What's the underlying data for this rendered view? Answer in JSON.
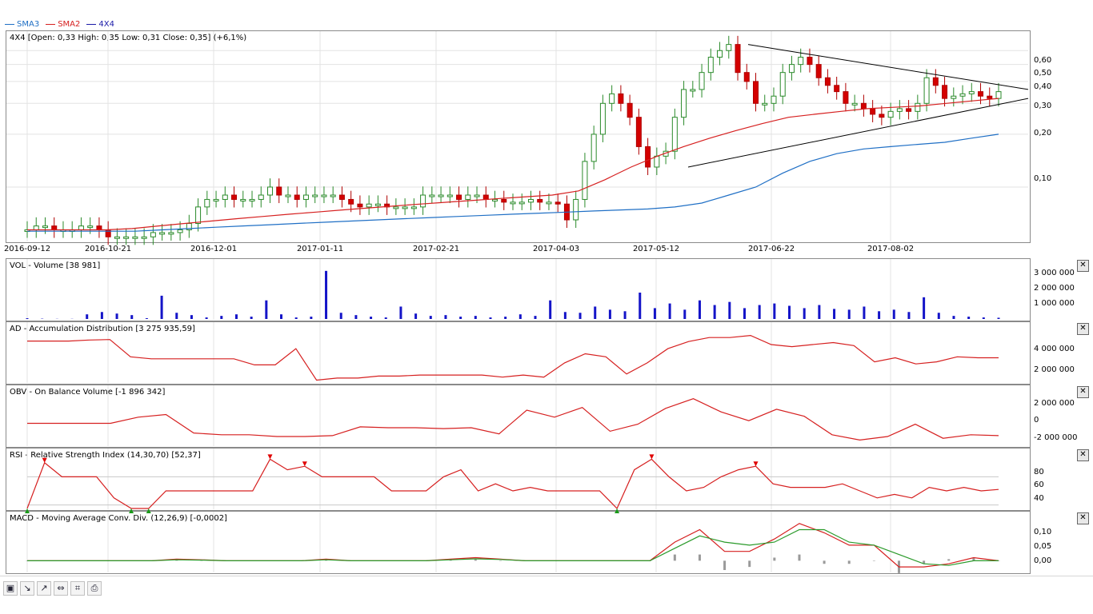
{
  "legend": [
    {
      "name": "SMA3",
      "color": "#1f6fc5"
    },
    {
      "name": "SMA2",
      "color": "#d62020"
    },
    {
      "name": "4X4",
      "color": "#1a1aa8"
    }
  ],
  "main_panel": {
    "title": "4X4 [Open: 0,33  High: 0,35  Low: 0,31  Close: 0,35] (+6,1%)",
    "y_ticks": [
      "0,60",
      "0,50",
      "0,40",
      "0,30",
      "0,20",
      "0,10"
    ],
    "x_ticks": [
      "2016-09-12",
      "2016-10-21",
      "2016-12-01",
      "2017-01-11",
      "2017-02-21",
      "2017-04-03",
      "2017-05-12",
      "2017-06-22",
      "2017-08-02"
    ]
  },
  "vol_panel": {
    "title": "VOL - Volume [38 981]",
    "y_ticks": [
      "3 000 000",
      "2 000 000",
      "1 000 000"
    ]
  },
  "ad_panel": {
    "title": "AD - Accumulation Distribution [3 275 935,59]",
    "y_ticks": [
      "4 000 000",
      "2 000 000"
    ]
  },
  "obv_panel": {
    "title": "OBV - On Balance Volume [-1 896 342]",
    "y_ticks": [
      "2 000 000",
      "0",
      "-2 000 000"
    ]
  },
  "rsi_panel": {
    "title": "RSI - Relative Strength Index (14,30,70) [52,37]",
    "y_ticks": [
      "80",
      "60",
      "40"
    ]
  },
  "macd_panel": {
    "title": "MACD - Moving Average Conv. Div. (12,26,9) [-0,0002]",
    "y_ticks": [
      "0,10",
      "0,05",
      "0,00"
    ]
  },
  "toolbar": {
    "icons": [
      "save-icon",
      "zoom-in-icon",
      "zoom-out-icon",
      "zoom-fit-icon",
      "fit-screen-icon",
      "print-icon"
    ]
  },
  "close_label": "✕",
  "chart_data": [
    {
      "type": "candlestick",
      "title": "4X4",
      "x_ticks": [
        "2016-09-12",
        "2016-10-21",
        "2016-12-01",
        "2017-01-11",
        "2017-02-21",
        "2017-04-03",
        "2017-05-12",
        "2017-06-22",
        "2017-08-02"
      ],
      "y_scale": "log",
      "ylim": [
        0.05,
        0.75
      ],
      "close": [
        0.057,
        0.06,
        0.06,
        0.057,
        0.057,
        0.057,
        0.06,
        0.06,
        0.057,
        0.052,
        0.052,
        0.052,
        0.052,
        0.052,
        0.055,
        0.055,
        0.055,
        0.057,
        0.062,
        0.077,
        0.085,
        0.085,
        0.09,
        0.085,
        0.085,
        0.085,
        0.09,
        0.1,
        0.09,
        0.09,
        0.085,
        0.09,
        0.09,
        0.09,
        0.09,
        0.085,
        0.08,
        0.077,
        0.08,
        0.08,
        0.077,
        0.077,
        0.077,
        0.077,
        0.09,
        0.09,
        0.09,
        0.09,
        0.085,
        0.09,
        0.09,
        0.085,
        0.085,
        0.082,
        0.082,
        0.082,
        0.085,
        0.082,
        0.082,
        0.08,
        0.065,
        0.085,
        0.14,
        0.2,
        0.3,
        0.34,
        0.3,
        0.25,
        0.17,
        0.13,
        0.15,
        0.16,
        0.25,
        0.36,
        0.36,
        0.45,
        0.55,
        0.6,
        0.65,
        0.45,
        0.4,
        0.3,
        0.3,
        0.33,
        0.45,
        0.5,
        0.55,
        0.5,
        0.42,
        0.38,
        0.35,
        0.3,
        0.3,
        0.28,
        0.26,
        0.25,
        0.27,
        0.28,
        0.27,
        0.3,
        0.42,
        0.38,
        0.32,
        0.33,
        0.34,
        0.35,
        0.33,
        0.32,
        0.35
      ],
      "sma_long": [
        0.056,
        0.056,
        0.056,
        0.056,
        0.056,
        0.057,
        0.058,
        0.059,
        0.06,
        0.061,
        0.062,
        0.063,
        0.064,
        0.065,
        0.066,
        0.067,
        0.068,
        0.069,
        0.07,
        0.071,
        0.072,
        0.073,
        0.074,
        0.075,
        0.077,
        0.081,
        0.09,
        0.1,
        0.12,
        0.14,
        0.155,
        0.165,
        0.17,
        0.175,
        0.18,
        0.19,
        0.2
      ],
      "sma_short": [
        0.057,
        0.057,
        0.057,
        0.057,
        0.058,
        0.06,
        0.062,
        0.064,
        0.066,
        0.068,
        0.07,
        0.072,
        0.074,
        0.076,
        0.078,
        0.08,
        0.082,
        0.084,
        0.086,
        0.088,
        0.09,
        0.095,
        0.11,
        0.13,
        0.15,
        0.17,
        0.19,
        0.21,
        0.23,
        0.25,
        0.26,
        0.27,
        0.28,
        0.285,
        0.29,
        0.3,
        0.31,
        0.32
      ],
      "trendlines": [
        {
          "from": [
            0.65
          ],
          "to": [
            0.36
          ]
        },
        {
          "from": [
            0.13
          ],
          "to": [
            0.32
          ]
        }
      ]
    },
    {
      "type": "bar",
      "title": "VOL - Volume",
      "values": [
        50000,
        20000,
        10000,
        10000,
        300000,
        450000,
        350000,
        250000,
        50000,
        1500000,
        400000,
        250000,
        100000,
        200000,
        300000,
        150000,
        1200000,
        300000,
        100000,
        150000,
        3100000,
        400000,
        250000,
        150000,
        100000,
        800000,
        350000,
        200000,
        250000,
        150000,
        200000,
        100000,
        150000,
        300000,
        200000,
        1200000,
        450000,
        400000,
        800000,
        600000,
        500000,
        1700000,
        700000,
        1000000,
        600000,
        1200000,
        900000,
        1100000,
        700000,
        900000,
        1000000,
        850000,
        700000,
        900000,
        650000,
        600000,
        800000,
        500000,
        600000,
        450000,
        1400000,
        400000,
        200000,
        150000,
        100000,
        80000
      ],
      "ylim": [
        0,
        3400000
      ]
    },
    {
      "type": "line",
      "title": "AD - Accumulation Distribution",
      "values": [
        4850000,
        4850000,
        4850000,
        4950000,
        5000000,
        3300000,
        3100000,
        3100000,
        3100000,
        3100000,
        3100000,
        2500000,
        2500000,
        4100000,
        1000000,
        1200000,
        1200000,
        1400000,
        1400000,
        1500000,
        1500000,
        1500000,
        1500000,
        1300000,
        1500000,
        1300000,
        2700000,
        3600000,
        3300000,
        1600000,
        2700000,
        4100000,
        4800000,
        5200000,
        5200000,
        5400000,
        4500000,
        4300000,
        4500000,
        4700000,
        4400000,
        2800000,
        3200000,
        2600000,
        2800000,
        3300000,
        3200000,
        3200000
      ],
      "ylim": [
        800000,
        6000000
      ]
    },
    {
      "type": "line",
      "title": "OBV - On Balance Volume",
      "values": [
        -500000,
        -500000,
        -500000,
        -500000,
        200000,
        500000,
        -1600000,
        -1800000,
        -1800000,
        -2000000,
        -2000000,
        -1900000,
        -900000,
        -1000000,
        -1000000,
        -1100000,
        -1000000,
        -1700000,
        1000000,
        200000,
        1300000,
        -1400000,
        -600000,
        1200000,
        2300000,
        800000,
        -200000,
        1100000,
        300000,
        -1800000,
        -2400000,
        -2000000,
        -600000,
        -2200000,
        -1800000,
        -1900000
      ],
      "ylim": [
        -3000000,
        3000000
      ]
    },
    {
      "type": "line",
      "title": "RSI - Relative Strength Index",
      "values": [
        25,
        90,
        70,
        70,
        70,
        40,
        25,
        25,
        50,
        50,
        50,
        50,
        50,
        50,
        95,
        80,
        85,
        70,
        70,
        70,
        70,
        50,
        50,
        50,
        70,
        80,
        50,
        60,
        50,
        55,
        50,
        50,
        50,
        50,
        25,
        80,
        95,
        70,
        50,
        55,
        70,
        80,
        85,
        60,
        55,
        55,
        55,
        60,
        50,
        40,
        45,
        40,
        55,
        50,
        55,
        50,
        52
      ],
      "ylim": [
        25,
        100
      ]
    },
    {
      "type": "line",
      "title": "MACD - Moving Average Conv. Div.",
      "series": [
        {
          "values": [
            0,
            0,
            0,
            0,
            0,
            0,
            0.005,
            0.003,
            0,
            0,
            0,
            0,
            0.005,
            0,
            0,
            0,
            0,
            0.005,
            0.01,
            0.005,
            0,
            0,
            0,
            0,
            0,
            0,
            0.06,
            0.1,
            0.03,
            0.03,
            0.07,
            0.12,
            0.09,
            0.05,
            0.05,
            -0.02,
            -0.02,
            -0.01,
            0.01,
            0
          ]
        },
        {
          "values": [
            0,
            0,
            0,
            0,
            0,
            0,
            0.003,
            0.002,
            0,
            0,
            0,
            0,
            0.003,
            0,
            0,
            0,
            0,
            0.003,
            0.006,
            0.004,
            0,
            0,
            0,
            0,
            0,
            0,
            0.04,
            0.08,
            0.06,
            0.05,
            0.06,
            0.1,
            0.1,
            0.06,
            0.05,
            0.02,
            -0.01,
            -0.015,
            0,
            0
          ]
        }
      ],
      "ylim": [
        -0.03,
        0.14
      ]
    }
  ]
}
